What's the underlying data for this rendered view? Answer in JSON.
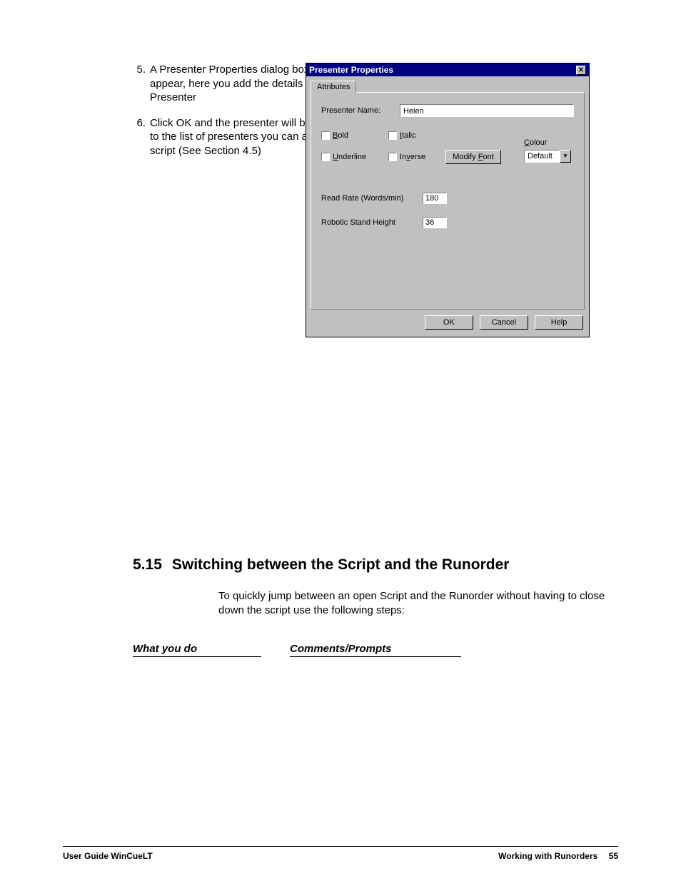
{
  "steps": [
    {
      "num": "5.",
      "text": "A Presenter Properties dialog box will appear, here you add the details of the Presenter"
    },
    {
      "num": "6.",
      "text": "Click OK and the presenter will be added to the list of presenters you can add to a script (See Section 4.5)"
    }
  ],
  "dialog": {
    "title": "Presenter Properties",
    "tab": "Attributes",
    "presenter_name_label": "Presenter Name:",
    "presenter_name_value": "Helen",
    "chk_bold": "Bold",
    "chk_italic": "Italic",
    "chk_underline": "Underline",
    "chk_inverse": "Inverse",
    "modify_font_label": "Modify Font",
    "colour_label": "Colour",
    "colour_value": "Default",
    "read_rate_label": "Read Rate (Words/min)",
    "read_rate_value": "180",
    "stand_label": "Robotic Stand Height",
    "stand_value": "36",
    "ok": "OK",
    "cancel": "Cancel",
    "help": "Help"
  },
  "section": {
    "num": "5.15",
    "title": "Switching between the Script and the Runorder",
    "body": "To quickly jump between an open Script and the Runorder without having to close down the script use the following steps:",
    "col1": "What you do",
    "col2": "Comments/Prompts"
  },
  "footer": {
    "left": "User Guide WinCueLT",
    "right_text": "Working with Runorders",
    "page": "55"
  }
}
